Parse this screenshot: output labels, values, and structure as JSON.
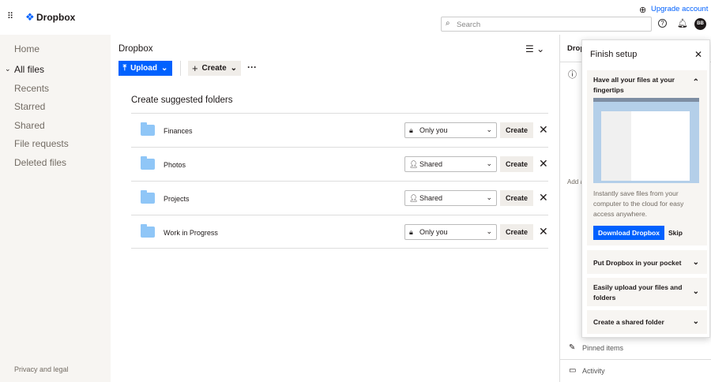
{
  "header": {
    "brand": "Dropbox",
    "upgrade": "Upgrade account",
    "search_placeholder": "Search",
    "avatar": "BB"
  },
  "sidebar": {
    "items": [
      {
        "label": "Home"
      },
      {
        "label": "All files"
      },
      {
        "label": "Recents"
      },
      {
        "label": "Starred"
      },
      {
        "label": "Shared"
      },
      {
        "label": "File requests"
      },
      {
        "label": "Deleted files"
      }
    ],
    "footer": "Privacy and legal"
  },
  "main": {
    "title": "Dropbox",
    "upload": "Upload",
    "create": "Create",
    "section_title": "Create suggested folders",
    "rows": [
      {
        "name": "Finances",
        "access": "Only you",
        "action": "Create"
      },
      {
        "name": "Photos",
        "access": "Shared",
        "action": "Create"
      },
      {
        "name": "Projects",
        "access": "Shared",
        "action": "Create"
      },
      {
        "name": "Work in Progress",
        "access": "Only you",
        "action": "Create"
      }
    ]
  },
  "right_panel": {
    "title": "Drop",
    "add_text": "Add a",
    "pinned": "Pinned items",
    "activity": "Activity"
  },
  "setup": {
    "title": "Finish setup",
    "card1_title": "Have all your files at your fingertips",
    "card1_desc": "Instantly save files from your computer to the cloud for easy access anywhere.",
    "download": "Download Dropbox",
    "skip": "Skip",
    "card2": "Put Dropbox in your pocket",
    "card3": "Easily upload your files and folders",
    "card4": "Create a shared folder"
  }
}
